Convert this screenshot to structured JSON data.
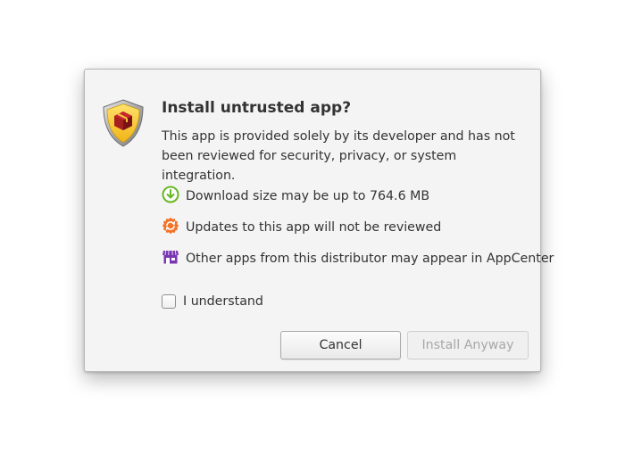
{
  "dialog": {
    "title": "Install untrusted app?",
    "description": "This app is provided solely by its developer and has not been reviewed for security, privacy, or system integration.",
    "icon": "security-shield-warning-icon",
    "items": [
      {
        "icon": "download-icon",
        "color": "#68b723",
        "text": "Download size may be up to 764.6 MB"
      },
      {
        "icon": "updates-icon",
        "color": "#f37329",
        "text": "Updates to this app will not be reviewed"
      },
      {
        "icon": "store-icon",
        "color": "#7a36b1",
        "text": "Other apps from this distributor may appear in AppCenter"
      }
    ],
    "checkbox": {
      "label": "I understand",
      "checked": false
    },
    "buttons": {
      "cancel": "Cancel",
      "install": "Install Anyway"
    },
    "colors": {
      "shield_yellow": "#f9c440",
      "warning_red": "#c6262e"
    }
  }
}
